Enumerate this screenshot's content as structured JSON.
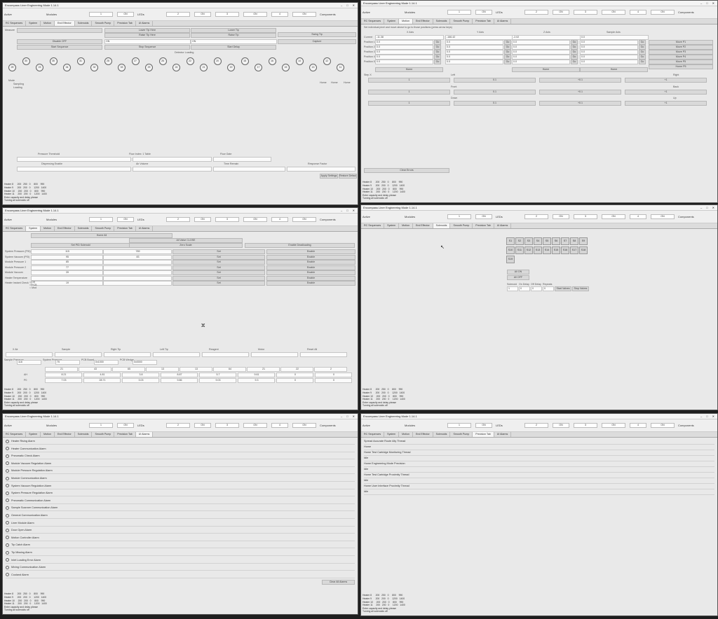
{
  "app": {
    "title": "Encompass Liner Engineering Mode 1.14.1",
    "header": {
      "active_label": "Active",
      "components_label": "Components",
      "modules_label": "Modules",
      "leds_label": "LEDs",
      "values": [
        "1",
        "2",
        "3",
        "4",
        "5",
        "6",
        "7",
        "8"
      ],
      "states": [
        "ON",
        "ON",
        "ON",
        "ON",
        "ON",
        "ON",
        "ON",
        "ON"
      ]
    },
    "tabs": [
      "RC Sequences",
      "System",
      "Motion",
      "End Effector",
      "Solenoids",
      "Smooth Pump",
      "Precision Tab",
      "UI Alarms"
    ]
  },
  "log": {
    "lines": [
      "Heater 8      200   250   0     800    990",
      "Heater 9      200   200   0     1200   1400",
      "Heater 10     200   200   0     800    990",
      "Heater 11     200   200   0     1200   1400",
      "Enter capacity and delay please",
      "Turning all solenoids off"
    ]
  },
  "panel1": {
    "top_row": [
      "Measure",
      "Lower Tip Here",
      "Lower Tip",
      "Swing Tip"
    ],
    "second_row": [
      "Raise Tip Here",
      "Raise Tip"
    ],
    "third_row": [
      "Disable OFF",
      "ON",
      "ON",
      "Capture"
    ],
    "fourth_row": [
      "Start Sequence",
      "Stop Sequence",
      "Start Delay"
    ],
    "section_label": "Detector Loading",
    "circles": [
      "25",
      "30",
      "23",
      "35",
      "34",
      "31",
      "32",
      "28",
      "33",
      "27",
      "29",
      "26",
      "24",
      "22",
      "21",
      "20",
      "19",
      "18",
      "17",
      "16",
      "15",
      "14",
      "13",
      "12",
      "11"
    ],
    "mode_options": [
      "Sampling",
      "Loading"
    ],
    "mode_title": "Mode",
    "side_buttons": [
      "Home",
      "Home",
      "Home"
    ],
    "lower_labels": [
      "Pressure Threshold",
      "Flow Index: 1 Table",
      "Flow Gate"
    ],
    "lower_labels2": [
      "Dispensing Enable",
      "Air Volume",
      "Time Remain",
      "Response Factor"
    ],
    "bottom_buttons": [
      "Apply Settings",
      "Restore Defaults"
    ]
  },
  "panel2": {
    "hint": "Set individual pixel and move above to go to those positions (press arrow keys)",
    "columns": [
      "X Axis",
      "Y Axis",
      "Z Axis",
      "Sample Axis"
    ],
    "current_label": "Current",
    "current_values": [
      "-11.38",
      "-166.42",
      "-2.02",
      "0.0"
    ],
    "positions": [
      {
        "label": "Position 1",
        "vals": [
          "0.0",
          "0.0",
          "0.0",
          "0.0"
        ]
      },
      {
        "label": "Position 2",
        "vals": [
          "0.0",
          "0.0",
          "0.0",
          "0.0"
        ]
      },
      {
        "label": "Position 3",
        "vals": [
          "0.0",
          "0.0",
          "0.0",
          "0.0"
        ]
      },
      {
        "label": "Position 4",
        "vals": [
          "0.0",
          "0.0",
          "0.0",
          "0.0"
        ]
      },
      {
        "label": "Position 5",
        "vals": [
          "0.0",
          "0.0",
          "0.0",
          "0.0"
        ]
      }
    ],
    "go_label": "Go",
    "move_buttons": [
      "Move P1",
      "Move P2",
      "Move P3",
      "Move P4",
      "Move P5",
      "Home P5"
    ],
    "home_buttons": [
      "Home",
      "Home",
      "Home"
    ],
    "left_label": "Left",
    "right_label": "Right",
    "front_label": "Front",
    "back_label": "Back",
    "down_label": "Down",
    "up_label": "Up",
    "step_values": [
      "1",
      "0.1",
      "+0.1",
      "+1"
    ],
    "clear_button": "Clear Errors"
  },
  "panel3": {
    "top_buttons": [
      "Home All",
      "All Valve CLOSE",
      "Set PID Solenoid",
      "Zero Scale",
      "Enable Deadloading"
    ],
    "rows": [
      {
        "label": "System Pressure (PSI) (1)",
        "a": "115",
        "b": "789",
        "btn": "Set",
        "btn2": "Enable"
      },
      {
        "label": "System Vacuum (PSI)",
        "a": "95",
        "b": "83",
        "btn": "Set",
        "btn2": "Enable"
      },
      {
        "label": "Module Pressure 1",
        "a": "85",
        "b": "",
        "btn": "Set",
        "btn2": "Enable"
      },
      {
        "label": "Module Pressure 2",
        "a": "77",
        "b": "",
        "btn": "Set",
        "btn2": "Enable"
      },
      {
        "label": "Module Vacuum",
        "a": "39",
        "b": "",
        "btn": "Set",
        "btn2": "Enable"
      },
      {
        "label": "Heater Temperature",
        "a": "",
        "b": "",
        "btn": "Set",
        "btn2": "Enable"
      },
      {
        "label": "Heater Instant Check",
        "a": "19",
        "b": "",
        "btn": "Set",
        "btn2": "Enable"
      }
    ],
    "radio": [
      "Off",
      "PCB",
      "Mod"
    ],
    "axes": [
      "X Air",
      "Sample",
      "Right Tip",
      "Left Tip",
      "Reagent",
      "Motor",
      "Reset All"
    ],
    "small_labels": [
      "Sample Pressure",
      "System Pressure",
      "PCB Board",
      "PCB Wedge"
    ],
    "small_values": [
      "118",
      "75",
      "0x1000",
      "0x0000"
    ],
    "grid_header": [
      "21",
      "43",
      "65",
      "13",
      "13",
      "64",
      "21",
      "22",
      "2"
    ],
    "grid_rows": [
      {
        "label": "AH",
        "vals": [
          "8.21",
          "4.81",
          "3.8",
          "8.87",
          "5.7",
          "9.61",
          "0",
          "0"
        ]
      },
      {
        "label": "P0",
        "vals": [
          "7.03",
          "28.71",
          "3.03",
          "9.86",
          "9.03",
          "9.3",
          "0",
          "0"
        ]
      }
    ]
  },
  "panel4": {
    "solenoids": [
      "S1",
      "S2",
      "S3",
      "S4",
      "S5",
      "S6",
      "S7",
      "S8",
      "S9",
      "S10",
      "S11",
      "S12",
      "S13",
      "S14",
      "S15",
      "S16",
      "S17",
      "S18",
      "S19"
    ],
    "all_on": "All ON",
    "all_off": "All OFF",
    "labels": [
      "Solenoid",
      "On Delay",
      "Off Delay",
      "Repeats"
    ],
    "values": [
      "1",
      "0",
      "0",
      "0"
    ],
    "start_button": "Start Valves",
    "stop_button": "Stop Valves"
  },
  "panel5": {
    "alarms": [
      "Heater Rising Alarm",
      "Heater Communication Alarm",
      "Pneumatic Check Alarm",
      "Module Vacuum Regulation Alarm",
      "Module Pressure Regulation Alarm",
      "Module Communication Alarm",
      "System Vacuum Regulation Alarm",
      "System Pressure Regulation Alarm",
      "Pneumatic Communication Alarm",
      "Sample Scanner Communication Alarm",
      "General Communication Alarm",
      "Liner Module Alarm",
      "Door Open Alarm",
      "Motion Controller Alarm",
      "Tip Catch Alarm",
      "Tip Missing Alarm",
      "Inlet Loading Error Alarm",
      "Mixing Communication Alarm",
      "Cooland Alarm"
    ],
    "clear_all": "Clear All Alarms"
  },
  "panel6": {
    "lines": [
      "Spread Accurate Route Ally Thread",
      "Home",
      "Home Test Cartridge Monitoring Thread",
      "Idle",
      "Home Engineering Mode Precision",
      "Idle",
      "Home Test Cartridge Proximity Thread",
      "Idle",
      "Home User Interface Proximity Thread",
      "Idle"
    ]
  }
}
